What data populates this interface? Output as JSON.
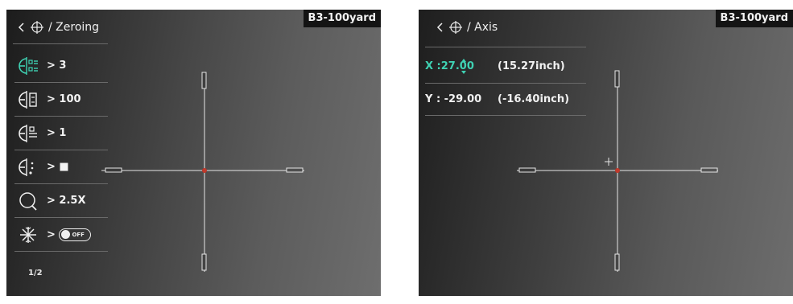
{
  "left_screen": {
    "profile_tag": "B3-100yard",
    "header": {
      "back_icon": "chevron-left-icon",
      "crosshair_icon": "crosshair-icon",
      "title": "/ Zeroing"
    },
    "menu": [
      {
        "icon": "zeroing-shots-icon",
        "value": "> 3"
      },
      {
        "icon": "zeroing-distance-icon",
        "value": "> 100"
      },
      {
        "icon": "zeroing-reticle-style-icon",
        "value": "> 1"
      },
      {
        "icon": "zeroing-reticle-color-icon",
        "value": "> ■"
      },
      {
        "icon": "zoom-icon",
        "value": "> 2.5X"
      },
      {
        "icon": "freeze-icon",
        "value": ">",
        "toggle_text": "OFF"
      }
    ],
    "page": "1/2"
  },
  "right_screen": {
    "profile_tag": "B3-100yard",
    "header": {
      "back_icon": "chevron-left-icon",
      "crosshair_icon": "crosshair-icon",
      "title": "/ Axis"
    },
    "x": {
      "label": "X :",
      "value": "27.00",
      "inches": "(15.27inch)"
    },
    "y": {
      "label": "Y : -29.00",
      "inches": "(-16.40inch)"
    }
  },
  "colors": {
    "accent": "#3fd2b3",
    "center_dot": "#c0392b",
    "reticle": "#e6e6e6"
  }
}
